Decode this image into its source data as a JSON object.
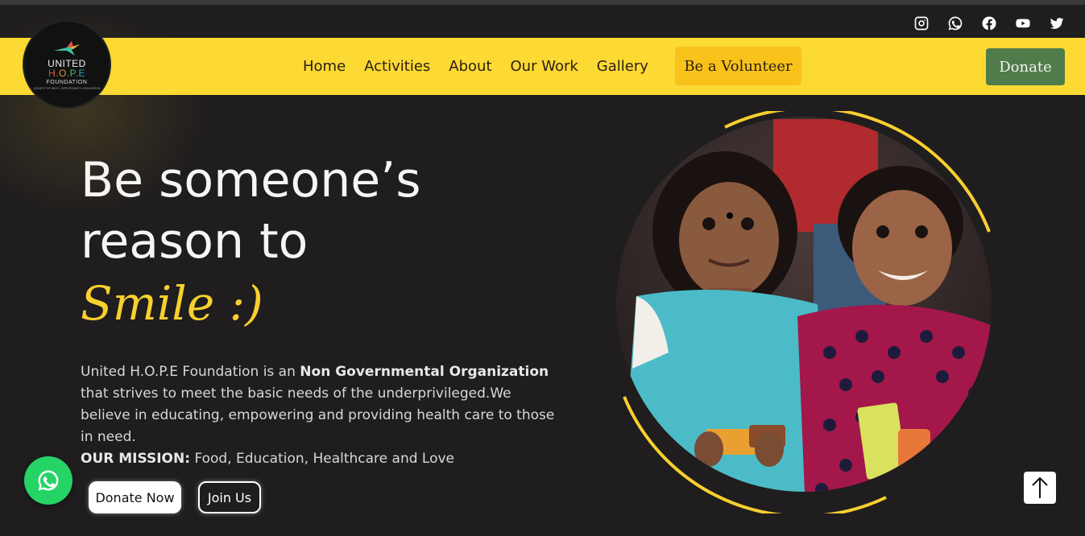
{
  "logo": {
    "line1": "UNITED",
    "line2": "H.O.P.E",
    "line3": "FOUNDATION",
    "tagline": "SOCIETY OF HELP • OPPORTUNITY • EDUCATION"
  },
  "social": {
    "icons": [
      "instagram-icon",
      "whatsapp-icon",
      "facebook-icon",
      "youtube-icon",
      "twitter-icon"
    ]
  },
  "nav": {
    "home": "Home",
    "activities": "Activities",
    "about": "About",
    "our_work": "Our Work",
    "gallery": "Gallery",
    "volunteer": "Be a Volunteer",
    "donate": "Donate"
  },
  "hero": {
    "line1": "Be someone’s",
    "line2": "reason to",
    "line3": "Smile :)",
    "desc_part1": "United H.O.P.E Foundation is an ",
    "desc_bold1": "Non Governmental Organization",
    "desc_part2": " that strives to meet the basic needs of the underprivileged.We believe in educating, empowering and providing health care to those in need.",
    "mission_label": "OUR MISSION:",
    "mission_text": " Food, Education, Healthcare and Love",
    "donate_now": "Donate Now",
    "join_us": "Join Us"
  },
  "colors": {
    "navbar": "#fcd933",
    "accent_yellow": "#f8cf2e",
    "donate_green": "#4f7c4a",
    "background": "#1f1d1e",
    "whatsapp_green": "#25d366"
  }
}
